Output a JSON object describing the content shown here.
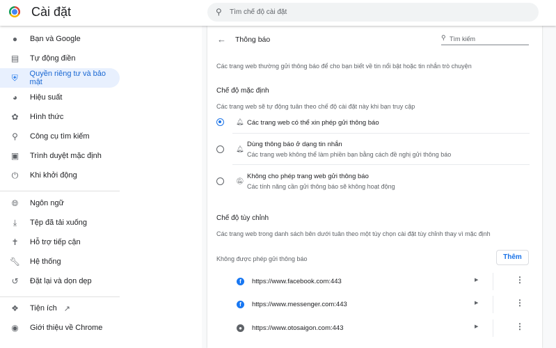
{
  "header": {
    "title": "Cài đặt",
    "search_placeholder": "Tìm chế độ cài đặt"
  },
  "sidebar": {
    "items": [
      {
        "label": "Bạn và Google",
        "icon": "person-icon"
      },
      {
        "label": "Tự động điền",
        "icon": "clipboard-icon"
      },
      {
        "label": "Quyền riêng tư và bảo mật",
        "icon": "shield-icon",
        "active": true
      },
      {
        "label": "Hiệu suất",
        "icon": "speedometer-icon"
      },
      {
        "label": "Hình thức",
        "icon": "palette-icon"
      },
      {
        "label": "Công cụ tìm kiếm",
        "icon": "search-icon"
      },
      {
        "label": "Trình duyệt mặc định",
        "icon": "browser-icon"
      },
      {
        "label": "Khi khởi động",
        "icon": "power-icon"
      },
      {
        "label": "Ngôn ngữ",
        "icon": "globe-icon"
      },
      {
        "label": "Tệp đã tải xuống",
        "icon": "download-icon"
      },
      {
        "label": "Hỗ trợ tiếp cận",
        "icon": "accessibility-icon"
      },
      {
        "label": "Hệ thống",
        "icon": "wrench-icon"
      },
      {
        "label": "Đặt lại và dọn dẹp",
        "icon": "restore-icon"
      },
      {
        "label": "Tiện ích",
        "icon": "puzzle-icon"
      },
      {
        "label": "Giới thiệu về Chrome",
        "icon": "chrome-icon"
      }
    ]
  },
  "main": {
    "title": "Thông báo",
    "search_placeholder": "Tìm kiếm",
    "description": "Các trang web thường gửi thông báo để cho bạn biết về tin nổi bật hoặc tin nhắn trò chuyện",
    "default_heading": "Chế độ mặc định",
    "default_desc": "Các trang web sẽ tự động tuân theo chế độ cài đặt này khi bạn truy cập",
    "options": [
      {
        "label": "Các trang web có thể xin phép gửi thông báo",
        "sub": "",
        "selected": true
      },
      {
        "label": "Dùng thông báo ở dạng tin nhắn",
        "sub": "Các trang web không thể làm phiền bạn bằng cách đề nghị gửi thông báo",
        "selected": false
      },
      {
        "label": "Không cho phép trang web gửi thông báo",
        "sub": "Các tính năng cần gửi thông báo sẽ không hoạt động",
        "selected": false
      }
    ],
    "custom_heading": "Chế độ tùy chỉnh",
    "custom_desc": "Các trang web trong danh sách bên dưới tuân theo một tùy chọn cài đặt tùy chỉnh thay vì mặc định",
    "blocked_label": "Không được phép gửi thông báo",
    "add_button": "Thêm",
    "sites": [
      {
        "url": "https://www.facebook.com:443",
        "icon": "facebook-icon"
      },
      {
        "url": "https://www.messenger.com:443",
        "icon": "facebook-icon"
      },
      {
        "url": "https://www.otosaigon.com:443",
        "icon": "globe-icon"
      }
    ]
  },
  "colors": {
    "accent": "#1a73e8",
    "active_bg": "#e8f0fe"
  }
}
